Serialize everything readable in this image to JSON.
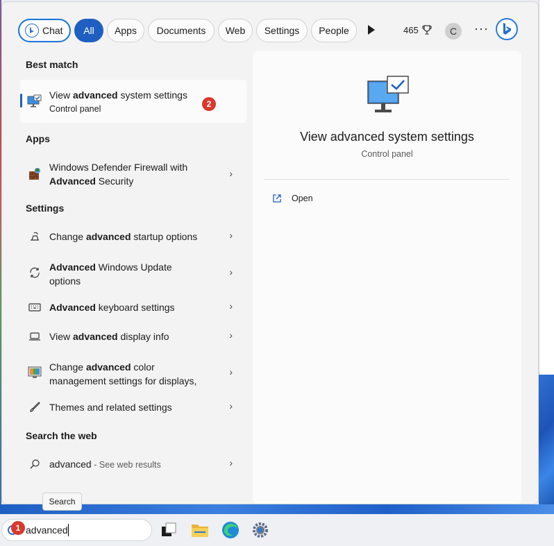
{
  "filters": {
    "chat": "Chat",
    "all": "All",
    "apps": "Apps",
    "documents": "Documents",
    "web": "Web",
    "settings": "Settings",
    "people": "People"
  },
  "header": {
    "points": "465",
    "avatar_initial": "C",
    "more": "···"
  },
  "best_match": {
    "section": "Best match",
    "title_pre": "View ",
    "title_bold": "advanced",
    "title_post": " system settings",
    "subtitle": "Control panel",
    "step_badge": "2"
  },
  "apps": {
    "section": "Apps",
    "items": [
      {
        "line1": "Windows Defender Firewall with",
        "bold": "Advanced",
        "post": " Security"
      }
    ]
  },
  "settings": {
    "section": "Settings",
    "items": [
      {
        "pre": "Change ",
        "bold": "advanced",
        "post": " startup options",
        "line2": ""
      },
      {
        "pre": "",
        "bold": "Advanced",
        "post": " Windows Update",
        "line2": "options"
      },
      {
        "pre": "",
        "bold": "Advanced",
        "post": " keyboard settings",
        "line2": ""
      },
      {
        "pre": "View ",
        "bold": "advanced",
        "post": " display info",
        "line2": ""
      },
      {
        "pre": "Change ",
        "bold": "advanced",
        "post": " color",
        "line2": "management settings for displays,"
      },
      {
        "pre": "Themes and related settings",
        "bold": "",
        "post": "",
        "line2": ""
      }
    ]
  },
  "web": {
    "section": "Search the web",
    "query": "advanced",
    "suffix": " - See web results"
  },
  "preview": {
    "title": "View advanced system settings",
    "subtitle": "Control panel",
    "open_label": "Open"
  },
  "tooltip": "Search",
  "taskbar": {
    "search_value": "advanced",
    "step_badge": "1"
  },
  "colors": {
    "accent": "#1f5fc1",
    "badge": "#d9382c"
  }
}
